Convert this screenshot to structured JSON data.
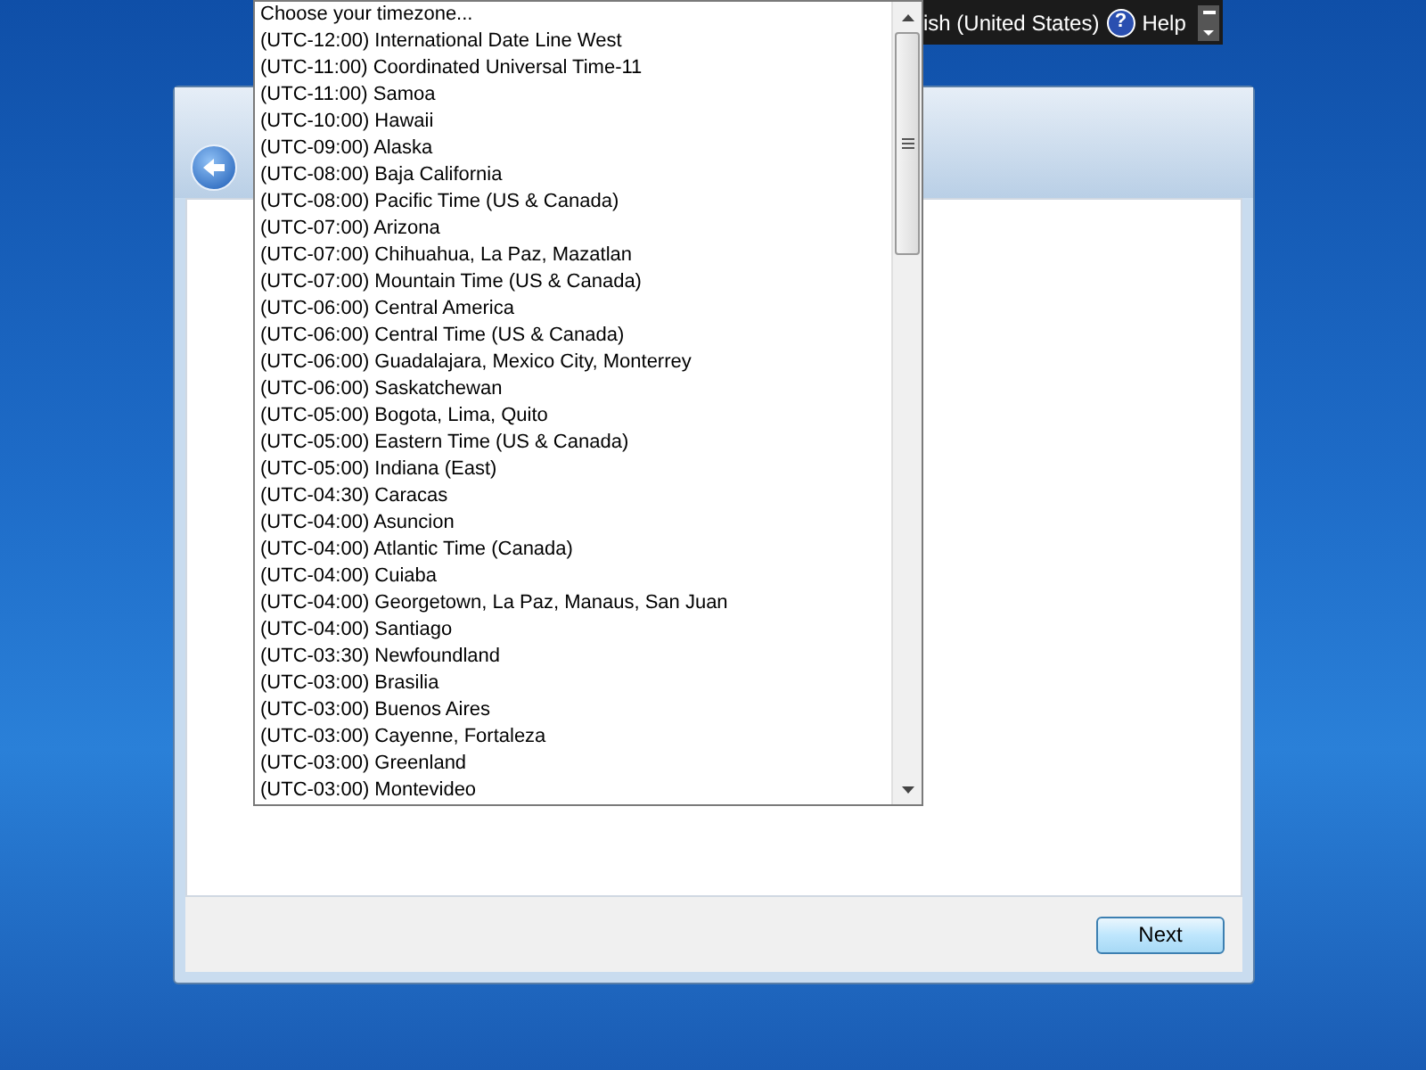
{
  "language_bar": {
    "language": "ish (United States)",
    "help_glyph": "?",
    "help": "Help"
  },
  "timezone_dropdown": {
    "placeholder": "Choose your timezone...",
    "options": [
      "(UTC-12:00) International Date Line West",
      "(UTC-11:00) Coordinated Universal Time-11",
      "(UTC-11:00) Samoa",
      "(UTC-10:00) Hawaii",
      "(UTC-09:00) Alaska",
      "(UTC-08:00) Baja California",
      "(UTC-08:00) Pacific Time (US & Canada)",
      "(UTC-07:00) Arizona",
      "(UTC-07:00) Chihuahua, La Paz, Mazatlan",
      "(UTC-07:00) Mountain Time (US & Canada)",
      "(UTC-06:00) Central America",
      "(UTC-06:00) Central Time (US & Canada)",
      "(UTC-06:00) Guadalajara, Mexico City, Monterrey",
      "(UTC-06:00) Saskatchewan",
      "(UTC-05:00) Bogota, Lima, Quito",
      "(UTC-05:00) Eastern Time (US & Canada)",
      "(UTC-05:00) Indiana (East)",
      "(UTC-04:30) Caracas",
      "(UTC-04:00) Asuncion",
      "(UTC-04:00) Atlantic Time (Canada)",
      "(UTC-04:00) Cuiaba",
      "(UTC-04:00) Georgetown, La Paz, Manaus, San Juan",
      "(UTC-04:00) Santiago",
      "(UTC-03:30) Newfoundland",
      "(UTC-03:00) Brasilia",
      "(UTC-03:00) Buenos Aires",
      "(UTC-03:00) Cayenne, Fortaleza",
      "(UTC-03:00) Greenland",
      "(UTC-03:00) Montevideo"
    ]
  },
  "buttons": {
    "next": "Next"
  }
}
